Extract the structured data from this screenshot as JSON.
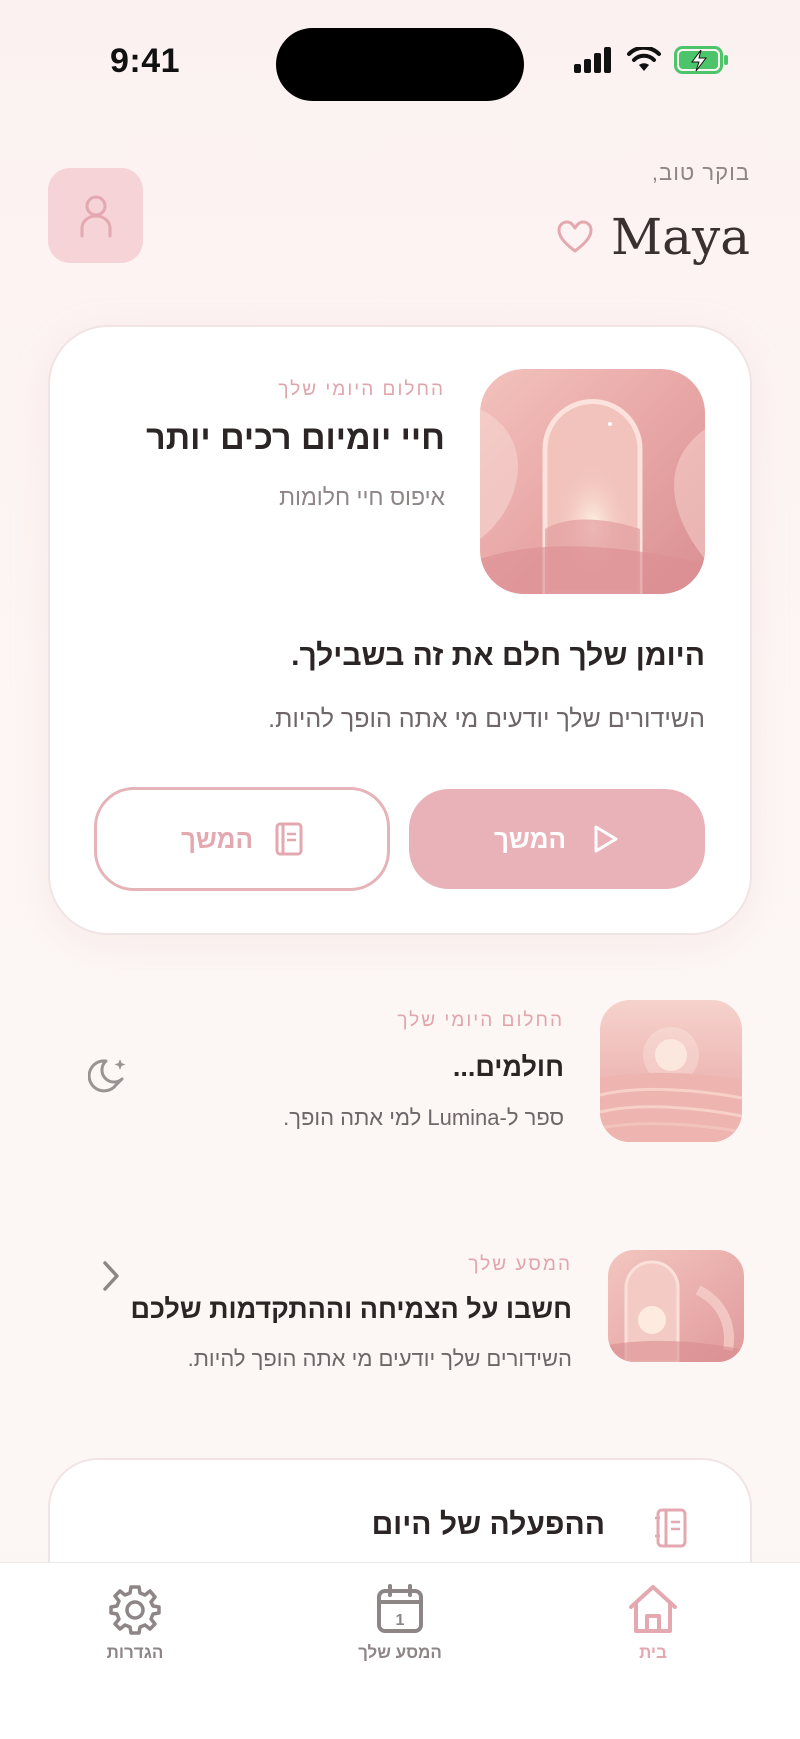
{
  "status_bar": {
    "time": "9:41"
  },
  "header": {
    "greeting": "בוקר טוב,",
    "name": "Maya"
  },
  "hero_card": {
    "eyebrow": "החלום היומי שלך",
    "title": "חיי יומיום רכים יותר",
    "subtitle": "איפוס חיי חלומות",
    "headline": "היומן שלך חלם את זה בשבילך.",
    "body": "השידורים שלך יודעים מי אתה הופך להיות.",
    "primary_button_label": "המשך",
    "secondary_button_label": "המשך"
  },
  "list_items": [
    {
      "eyebrow": "החלום היומי שלך",
      "title": "חולמים...",
      "subtitle": "ספר ל-Lumina למי אתה הופך."
    },
    {
      "eyebrow": "המסע שלך",
      "title": "חשבו על הצמיחה וההתקדמות שלכם",
      "subtitle": "השידורים שלך יודעים מי אתה הופך להיות."
    }
  ],
  "daily_card": {
    "title": "ההפעלה של היום"
  },
  "tabbar": {
    "home_label": "בית",
    "journey_label": "המסע שלך",
    "settings_label": "הגדרות",
    "calendar_day": "1"
  },
  "colors": {
    "accent": "#e9b2b9",
    "accent_text": "#e1a5ac",
    "text": "#2b2526",
    "muted": "#8e8587"
  }
}
